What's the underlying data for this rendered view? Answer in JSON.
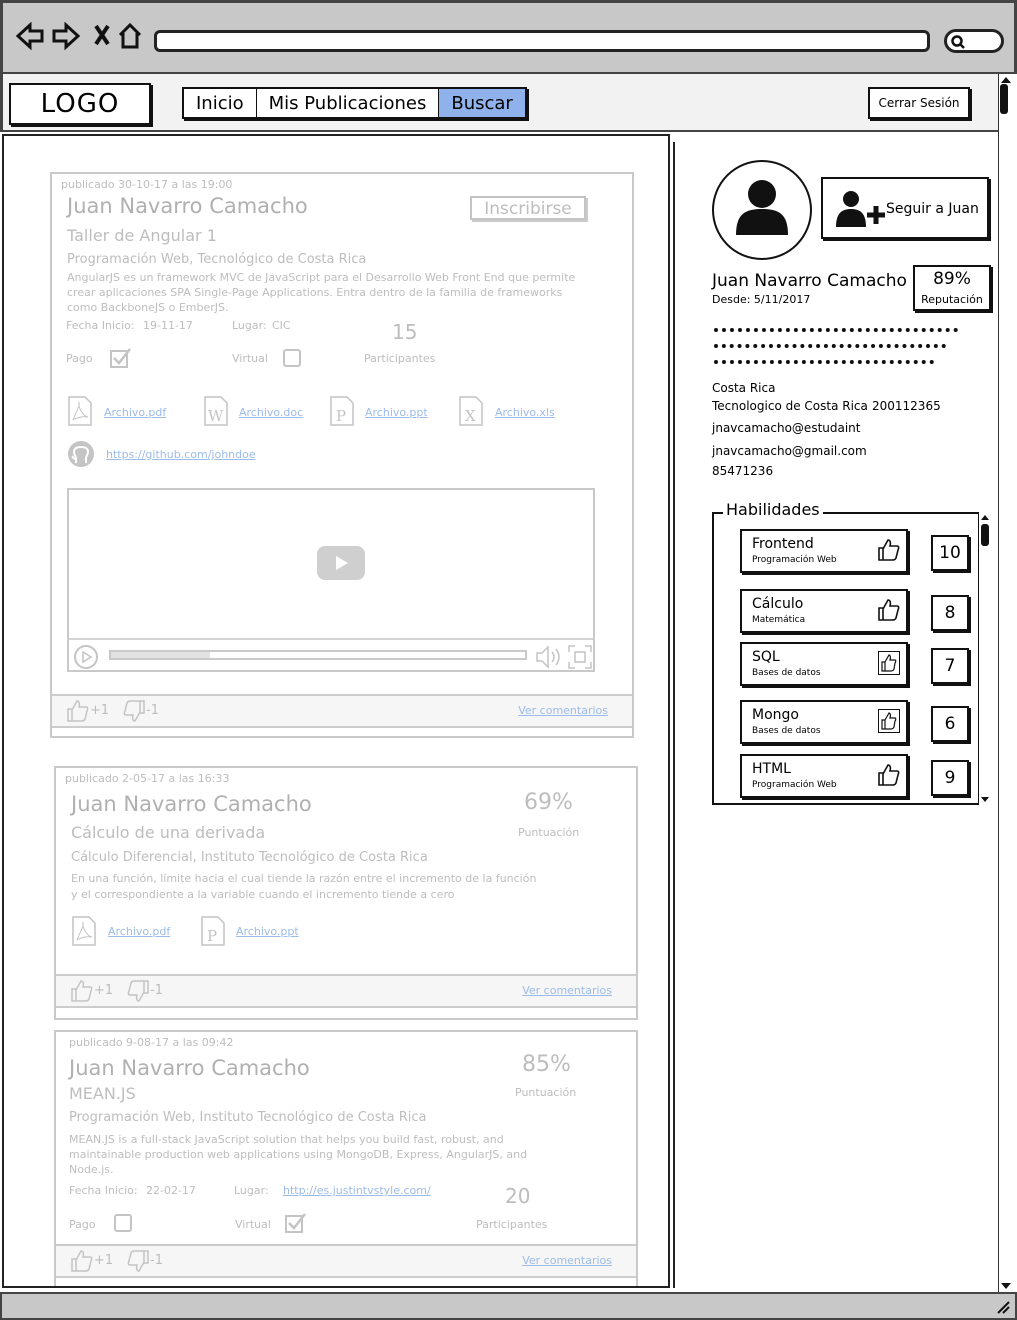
{
  "browser": {
    "nav_icons": [
      "back-arrow-icon",
      "forward-arrow-icon",
      "close-x-icon",
      "home-icon"
    ],
    "search_icon": "magnifier-icon"
  },
  "header": {
    "logo": "LOGO",
    "tabs": [
      {
        "label": "Inicio",
        "active": false
      },
      {
        "label": "Mis Publicaciones",
        "active": false
      },
      {
        "label": "Buscar",
        "active": true
      }
    ],
    "logout": "Cerrar Sesión",
    "active_tab_color": "#8fb2ec"
  },
  "posts": [
    {
      "published": "publicado 30-10-17 a las 19:00",
      "author": "Juan Navarro Camacho",
      "action": "Inscribirse",
      "title": "Taller de Angular 1",
      "category": "Programación Web, Tecnológico de Costa Rica",
      "description": "AngularJS es un framework MVC de JavaScript para el Desarrollo Web Front End que permite crear aplicaciones SPA Single-Page Applications. Entra dentro de la familia de frameworks como BackboneJS o EmberJS.",
      "start_label": "Fecha Inicio:",
      "start_date": "19-11-17",
      "place_label": "Lugar:",
      "place": "CIC",
      "participants": "15",
      "participants_label": "Participantes",
      "pago_label": "Pago",
      "pago_checked": true,
      "virtual_label": "Virtual",
      "virtual_checked": false,
      "files": [
        "Archivo.pdf",
        "Archivo.doc",
        "Archivo.ppt",
        "Archivo.xls"
      ],
      "repo": "https://github.com/johndoe",
      "video_progress": 0.24,
      "likes": "+1",
      "dislikes": "-1",
      "comments": "Ver comentarios"
    },
    {
      "published": "publicado 2-05-17 a las 16:33",
      "author": "Juan Navarro Camacho",
      "score": "69%",
      "score_label": "Puntuación",
      "title": "Cálculo de una derivada",
      "category": "Cálculo Diferencial, Instituto Tecnológico de Costa Rica",
      "description": "En una función, límite hacia el cual tiende la razón entre el incremento de la función y el correspondiente a la variable cuando el incremento tiende a cero",
      "files": [
        "Archivo.pdf",
        "Archivo.ppt"
      ],
      "likes": "+1",
      "dislikes": "-1",
      "comments": "Ver comentarios"
    },
    {
      "published": "publicado 9-08-17 a las 09:42",
      "author": "Juan Navarro Camacho",
      "score": "85%",
      "score_label": "Puntuación",
      "title": "MEAN.JS",
      "category": "Programación Web, Instituto Tecnológico de Costa Rica",
      "description": "MEAN.JS is a full-stack JavaScript solution that helps you build fast, robust, and maintainable production web applications using MongoDB, Express, AngularJS, and Node.js.",
      "start_label": "Fecha Inicio:",
      "start_date": "22-02-17",
      "place_label": "Lugar:",
      "place": "http://es.justintvstyle.com/",
      "participants": "20",
      "participants_label": "Participantes",
      "pago_label": "Pago",
      "pago_checked": false,
      "virtual_label": "Virtual",
      "virtual_checked": true,
      "likes": "+1",
      "dislikes": "-1",
      "comments": "Ver comentarios"
    }
  ],
  "profile": {
    "follow": "Seguir a Juan",
    "name": "Juan Navarro Camacho",
    "since": "Desde: 5/11/2017",
    "reputation": "89%",
    "reputation_label": "Reputación",
    "country": "Costa Rica",
    "institution": "Tecnologico de Costa Rica",
    "student_id": "200112365",
    "email1": "jnavcamacho@estudaint",
    "email2": "jnavcamacho@gmail.com",
    "phone": "85471236",
    "skills_title": "Habilidades",
    "skills": [
      {
        "name": "Frontend",
        "area": "Programación Web",
        "count": "10"
      },
      {
        "name": "Cálculo",
        "area": "Matemática",
        "count": "8"
      },
      {
        "name": "SQL",
        "area": "Bases de datos",
        "count": "7"
      },
      {
        "name": "Mongo",
        "area": "Bases de datos",
        "count": "6"
      },
      {
        "name": "HTML",
        "area": "Programación Web",
        "count": "9"
      }
    ]
  }
}
